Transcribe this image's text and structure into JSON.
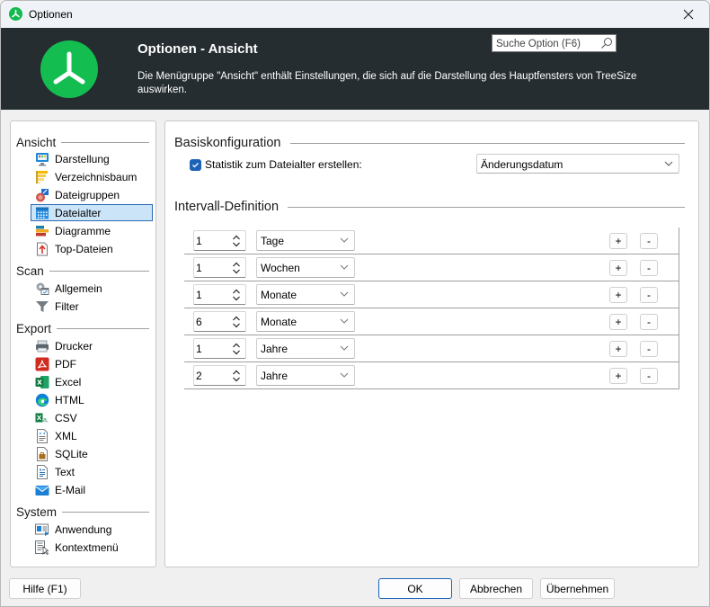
{
  "window": {
    "title": "Optionen",
    "close_label": "Schließen"
  },
  "banner": {
    "heading": "Optionen - Ansicht",
    "description": "Die Menügruppe \"Ansicht\" enthält Einstellungen, die sich auf die Darstellung des Hauptfensters von TreeSize auswirken.",
    "search_placeholder": "Suche Option (F6)",
    "brand_color": "#13bd50"
  },
  "nav": {
    "groups": [
      {
        "label": "Ansicht",
        "items": [
          {
            "label": "Darstellung",
            "icon": "monitor-icon"
          },
          {
            "label": "Verzeichnisbaum",
            "icon": "tree-list-icon"
          },
          {
            "label": "Dateigruppen",
            "icon": "file-groups-icon"
          },
          {
            "label": "Dateialter",
            "icon": "calendar-icon",
            "selected": true
          },
          {
            "label": "Diagramme",
            "icon": "bar-chart-icon"
          },
          {
            "label": "Top-Dateien",
            "icon": "top-files-icon"
          }
        ]
      },
      {
        "label": "Scan",
        "items": [
          {
            "label": "Allgemein",
            "icon": "gear-calendar-icon"
          },
          {
            "label": "Filter",
            "icon": "filter-icon"
          }
        ]
      },
      {
        "label": "Export",
        "items": [
          {
            "label": "Drucker",
            "icon": "printer-icon"
          },
          {
            "label": "PDF",
            "icon": "pdf-icon"
          },
          {
            "label": "Excel",
            "icon": "excel-icon"
          },
          {
            "label": "HTML",
            "icon": "edge-browser-icon"
          },
          {
            "label": "CSV",
            "icon": "csv-icon"
          },
          {
            "label": "XML",
            "icon": "xml-file-icon"
          },
          {
            "label": "SQLite",
            "icon": "database-file-icon"
          },
          {
            "label": "Text",
            "icon": "text-file-icon"
          },
          {
            "label": "E-Mail",
            "icon": "mail-icon"
          }
        ]
      },
      {
        "label": "System",
        "items": [
          {
            "label": "Anwendung",
            "icon": "application-icon"
          },
          {
            "label": "Kontextmenü",
            "icon": "context-menu-icon"
          }
        ]
      }
    ]
  },
  "content": {
    "basis": {
      "heading": "Basiskonfiguration",
      "checkbox_label": "Statistik zum Dateialter erstellen:",
      "checkbox_checked": true,
      "date_select_value": "Änderungsdatum"
    },
    "intervals": {
      "heading": "Intervall-Definition",
      "add_label": "+",
      "remove_label": "-",
      "rows": [
        {
          "value": "1",
          "unit": "Tage"
        },
        {
          "value": "1",
          "unit": "Wochen"
        },
        {
          "value": "1",
          "unit": "Monate"
        },
        {
          "value": "6",
          "unit": "Monate"
        },
        {
          "value": "1",
          "unit": "Jahre"
        },
        {
          "value": "2",
          "unit": "Jahre"
        }
      ]
    }
  },
  "footer": {
    "help_label": "Hilfe (F1)",
    "ok_label": "OK",
    "cancel_label": "Abbrechen",
    "apply_label": "Übernehmen"
  }
}
